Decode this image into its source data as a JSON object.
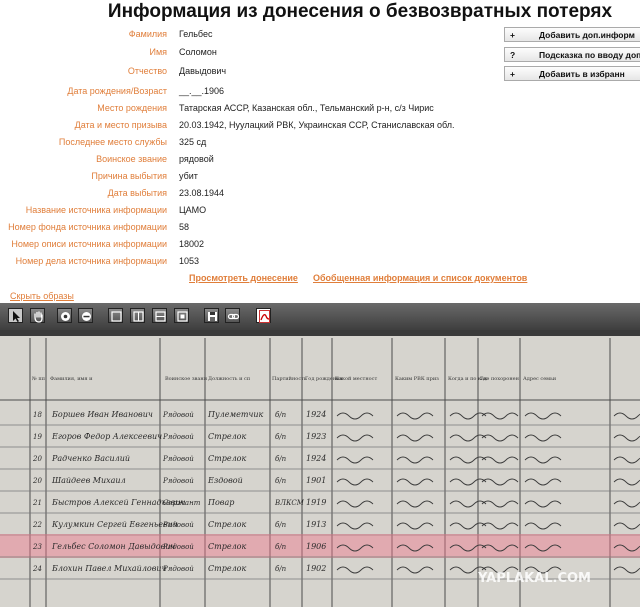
{
  "page_title": "Информация из донесения о безвозвратных потерях",
  "fields": [
    {
      "label": "Фамилия",
      "value": "Гельбес"
    },
    {
      "label": "Имя",
      "value": "Соломон"
    },
    {
      "label": "Отчество",
      "value": "Давыдович"
    },
    {
      "label": "Дата рождения/Возраст",
      "value": "__.__.1906"
    },
    {
      "label": "Место рождения",
      "value": "Татарская АССР, Казанская обл., Тельманский р-н, с/з Чирис"
    },
    {
      "label": "Дата и место призыва",
      "value": "20.03.1942, Нуулацкий РВК, Украинская ССР, Станиславская обл."
    },
    {
      "label": "Последнее место службы",
      "value": "325 сд"
    },
    {
      "label": "Воинское звание",
      "value": "рядовой"
    },
    {
      "label": "Причина выбытия",
      "value": "убит"
    },
    {
      "label": "Дата выбытия",
      "value": "23.08.1944"
    },
    {
      "label": "Название источника информации",
      "value": "ЦАМО"
    },
    {
      "label": "Номер фонда источника информации",
      "value": "58"
    },
    {
      "label": "Номер описи источника информации",
      "value": "18002"
    },
    {
      "label": "Номер дела источника информации",
      "value": "1053"
    }
  ],
  "side_buttons": [
    {
      "symbol": "+",
      "label": "Добавить доп.информ"
    },
    {
      "symbol": "?",
      "label": "Подсказка по вводу доп.ин"
    },
    {
      "symbol": "+",
      "label": "Добавить в избранн"
    }
  ],
  "links": {
    "view_report": "Просмотреть донесение",
    "summary": "Обобщенная информация и список документов"
  },
  "hide_images": "Скрыть образы",
  "toolbar": {
    "tools": [
      "pointer-tool",
      "hand-tool",
      "zoom-in",
      "zoom-out",
      "fit-page",
      "fit-width",
      "fit-height",
      "actual-size",
      "save",
      "link",
      "pdf"
    ]
  },
  "document": {
    "headers": [
      "№ пп",
      "Фамилия, имя и отчество",
      "Воинское звание",
      "Должность и специальность",
      "Партийность",
      "Год рождения",
      "Какой местности уроженец",
      "Каким РВК призван",
      "Когда и по какой причине выбыл",
      "Где похоронен",
      "Адрес семьи"
    ],
    "rows": [
      {
        "num": "18",
        "name": "Боршев Иван Иванович",
        "rank": "Рядовой",
        "role": "Пулеметчик",
        "party": "б/п",
        "year": "1924"
      },
      {
        "num": "19",
        "name": "Егоров Федор Алексеевич",
        "rank": "Рядовой",
        "role": "Стрелок",
        "party": "б/п",
        "year": "1923"
      },
      {
        "num": "20",
        "name": "Радченко Василий",
        "rank": "Рядовой",
        "role": "Стрелок",
        "party": "б/п",
        "year": "1924"
      },
      {
        "num": "20",
        "name": "Шайдеев Михаил",
        "rank": "Рядовой",
        "role": "Ездовой",
        "party": "б/п",
        "year": "1901"
      },
      {
        "num": "21",
        "name": "Быстров Алексей Геннадьевич",
        "rank": "Сержант",
        "role": "Повар",
        "party": "ВЛКСМ",
        "year": "1919"
      },
      {
        "num": "22",
        "name": "Кулумкин Сергей Евгеньевич",
        "rank": "Рядовой",
        "role": "Стрелок",
        "party": "б/п",
        "year": "1913"
      },
      {
        "num": "23",
        "name": "Гельбес Соломон Давыдович",
        "rank": "Рядовой",
        "role": "Стрелок",
        "party": "б/п",
        "year": "1906",
        "highlight": true
      },
      {
        "num": "24",
        "name": "Блохин Павел Михайлович",
        "rank": "Рядовой",
        "role": "Стрелок",
        "party": "б/п",
        "year": "1902"
      }
    ],
    "watermark": "YAPLAKAL.COM"
  },
  "colors": {
    "label": "#e07e3a",
    "toolbar": "#4a4a4a",
    "highlight": "rgba(240,120,140,0.45)"
  }
}
